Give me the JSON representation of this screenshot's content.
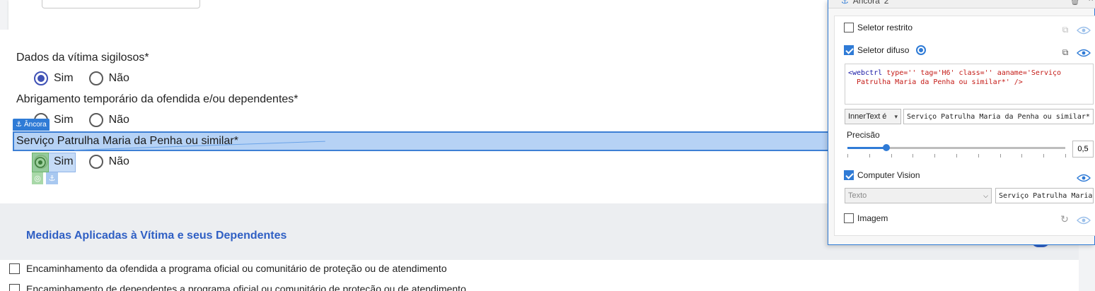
{
  "form": {
    "q1": {
      "label": "Dados da vítima sigilosos*",
      "yes": "Sim",
      "no": "Não"
    },
    "q2": {
      "label": "Abrigamento temporário da ofendida e/ou dependentes*",
      "yes": "Sim",
      "no": "Não"
    },
    "q3": {
      "label": "Serviço Patrulha Maria da Penha ou similar*",
      "yes": "Sim",
      "no": "Não"
    },
    "anchor_tag": "Âncora"
  },
  "section": {
    "title": "Medidas Aplicadas à Vítima e seus Dependentes",
    "items": [
      "Encaminhamento da ofendida a programa oficial ou comunitário de proteção ou de atendimento",
      "Encaminhamento de dependentes a programa oficial ou comunitário de proteção ou de atendimento"
    ]
  },
  "panel": {
    "header_title": "Âncora",
    "header_count": "2",
    "strict_selector": "Seletor restrito",
    "fuzzy_selector": "Seletor difuso",
    "code": {
      "line1_tag": "<webctrl",
      "line1_rest": " type='' tag='H6' class='' aaname='Serviço",
      "line2": "Patrulha Maria da Penha ou similar*' />"
    },
    "innertext_option": "InnerText é",
    "innertext_value": "Serviço Patrulha Maria da Penha ou similar*",
    "precision_label": "Precisão",
    "precision_value": "0,5",
    "precision_fraction": 0.18,
    "computer_vision": "Computer Vision",
    "cv_type": "Texto",
    "cv_value": "Serviço Patrulha Maria",
    "image": "Imagem"
  },
  "colors": {
    "accent": "#2f7bd6",
    "section_title": "#2f5fc4",
    "radio": "#3f51b5"
  }
}
